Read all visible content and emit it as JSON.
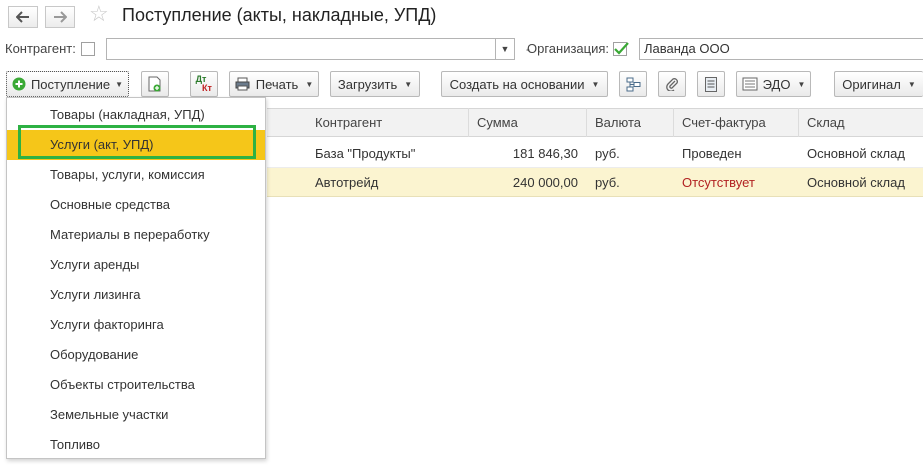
{
  "title": "Поступление (акты, накладные, УПД)",
  "filters": {
    "counterparty_label": "Контрагент:",
    "counterparty_value": "",
    "organization_label": "Организация:",
    "organization_value": "Лаванда ООО",
    "organization_checked": true
  },
  "toolbar": {
    "receipt_label": "Поступление",
    "dtkt_label_top": "Дт",
    "dtkt_label_bottom": "Кт",
    "print_label": "Печать",
    "load_label": "Загрузить",
    "create_based_label": "Создать на основании",
    "edo_label": "ЭДО",
    "original_label": "Оригинал"
  },
  "table": {
    "columns": [
      "Контрагент",
      "Сумма",
      "Валюта",
      "Счет-фактура",
      "Склад"
    ],
    "rows": [
      {
        "counterparty": "База \"Продукты\"",
        "sum": "181 846,30",
        "currency": "руб.",
        "invoice": "Проведен",
        "warehouse": "Основной склад"
      },
      {
        "counterparty": "Автотрейд",
        "sum": "240 000,00",
        "currency": "руб.",
        "invoice": "Отсутствует",
        "warehouse": "Основной склад"
      }
    ]
  },
  "menu": {
    "items": [
      "Товары (накладная, УПД)",
      "Услуги (акт, УПД)",
      "Товары, услуги, комиссия",
      "Основные средства",
      "Материалы в переработку",
      "Услуги аренды",
      "Услуги лизинга",
      "Услуги факторинга",
      "Оборудование",
      "Объекты строительства",
      "Земельные участки",
      "Топливо"
    ],
    "selected_index": 1
  },
  "colors": {
    "selected_item": "#f5c619",
    "highlight_frame": "#2db143",
    "selected_row": "#fbf4d0",
    "missing_invoice": "#b22222",
    "checkbox_green": "#3aa935"
  },
  "icons": [
    "back-arrow-icon",
    "forward-arrow-icon",
    "star-icon",
    "plus-circle-icon",
    "document-add-icon",
    "dt-kt-icon",
    "printer-icon",
    "structure-icon",
    "paperclip-icon",
    "list-icon",
    "edo-icon"
  ]
}
